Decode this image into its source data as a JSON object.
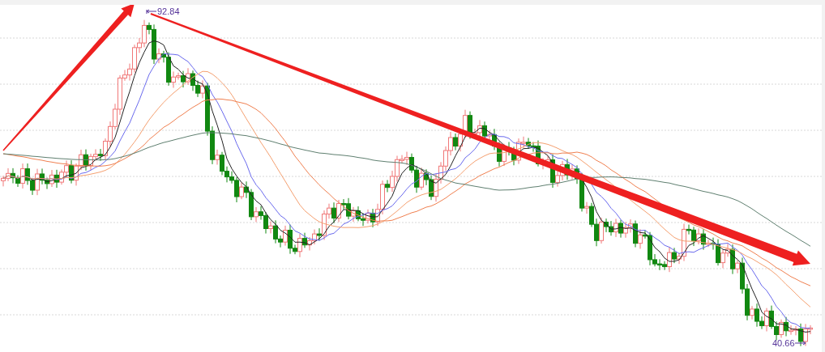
{
  "chart": {
    "high_label": "92.84",
    "low_label": "40.66"
  }
}
